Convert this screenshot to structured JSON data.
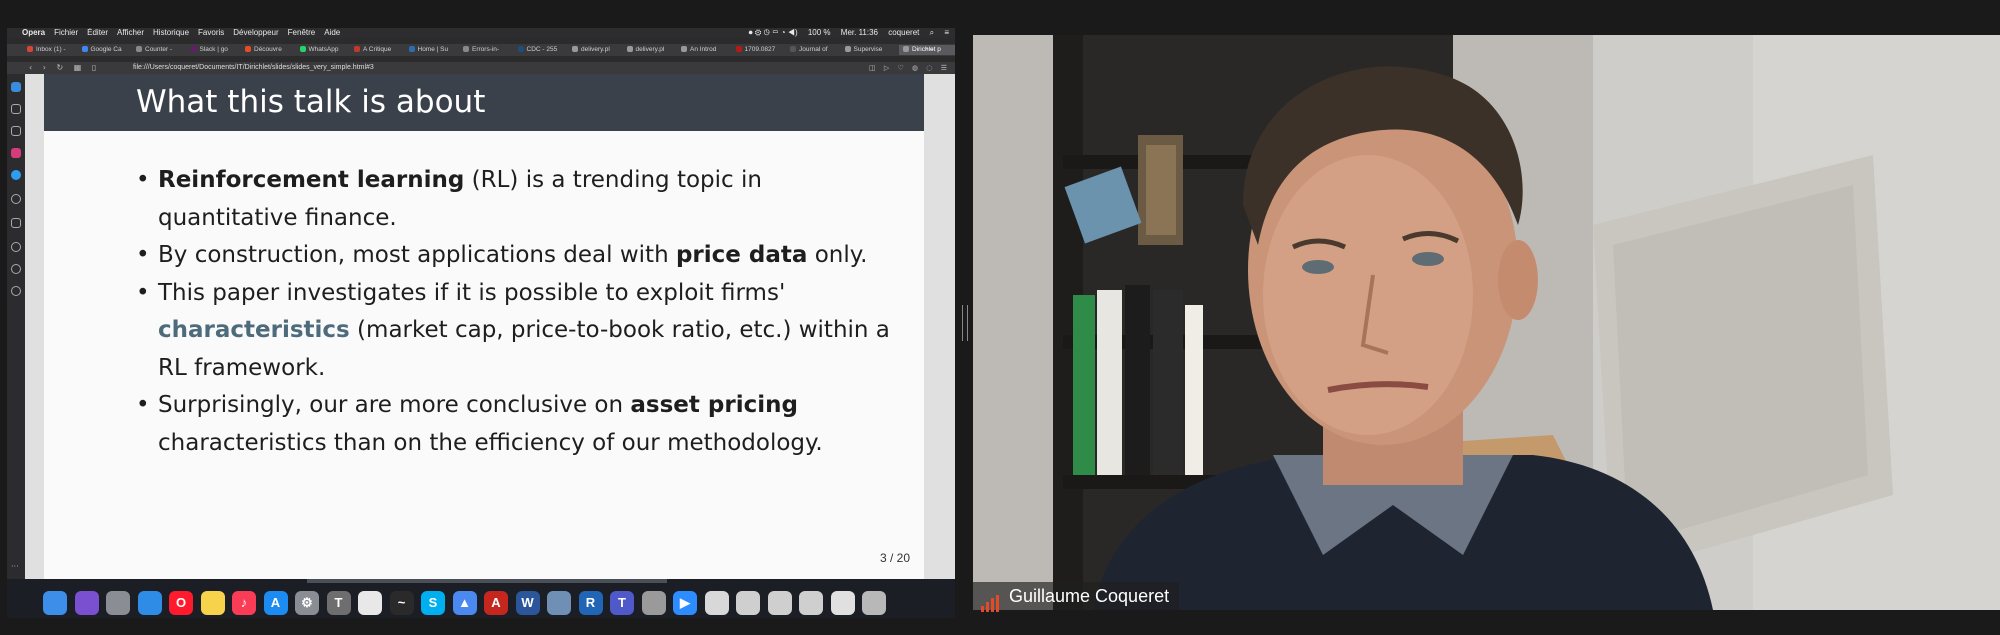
{
  "macbar": {
    "left": [
      "",
      "Opera",
      "Fichier",
      "Éditer",
      "Afficher",
      "Historique",
      "Favoris",
      "Développeur",
      "Fenêtre",
      "Aide"
    ],
    "battery": "100 %",
    "datetime": "Mer. 11:36",
    "user": "coqueret"
  },
  "tabs": [
    {
      "label": "Inbox (1) -",
      "color": "#d44638"
    },
    {
      "label": "Google Ca",
      "color": "#4285f4"
    },
    {
      "label": "Counter -",
      "color": "#888888"
    },
    {
      "label": "Slack | go",
      "color": "#611f69"
    },
    {
      "label": "Découvre",
      "color": "#e44d26"
    },
    {
      "label": "WhatsApp",
      "color": "#25d366"
    },
    {
      "label": "A Critique",
      "color": "#c0392b"
    },
    {
      "label": "Home | Su",
      "color": "#2a6db0"
    },
    {
      "label": "Errors-in-",
      "color": "#888888"
    },
    {
      "label": "CDC - 255",
      "color": "#1f4e79"
    },
    {
      "label": "delivery.pl",
      "color": "#999999"
    },
    {
      "label": "delivery.pl",
      "color": "#999999"
    },
    {
      "label": "An Introd",
      "color": "#999999"
    },
    {
      "label": "1709.0827",
      "color": "#b31b1b"
    },
    {
      "label": "Journal of",
      "color": "#555555"
    },
    {
      "label": "Supervise",
      "color": "#999999"
    },
    {
      "label": "Dirichlet p",
      "color": "#999999",
      "active": true
    }
  ],
  "url": "file:///Users/coqueret/Documents/IT/Dirichlet/slides/slides_very_simple.html#3",
  "slide": {
    "title": "What this talk is about",
    "page": "3 / 20",
    "bullets": [
      {
        "bold": "Reinforcement learning",
        "rest": " (RL) is a trending topic in quantitative finance."
      },
      {
        "pre": "By construction, most applications deal with ",
        "bold": "price data",
        "post": " only."
      },
      {
        "pre": "This paper investigates if it is possible to exploit firms' ",
        "accent": "characteristics",
        "post": " (market cap, price-to-book ratio, etc.) within a RL framework."
      },
      {
        "pre": "Surprisingly, our are more conclusive on ",
        "bold": "asset pricing",
        "post": " characteristics than on the efficiency of our methodology."
      }
    ]
  },
  "dock": [
    {
      "icon": "finder-icon",
      "color": "#3d8ee8",
      "glyph": ""
    },
    {
      "icon": "siri-icon",
      "color": "#7a4fd0",
      "glyph": ""
    },
    {
      "icon": "launchpad-icon",
      "color": "#8a8d93",
      "glyph": ""
    },
    {
      "icon": "safari-icon",
      "color": "#2f8ce6",
      "glyph": ""
    },
    {
      "icon": "opera-icon",
      "color": "#ff1b2d",
      "glyph": "O"
    },
    {
      "icon": "notes-icon",
      "color": "#f6d34a",
      "glyph": ""
    },
    {
      "icon": "music-icon",
      "color": "#fa3c57",
      "glyph": "♪"
    },
    {
      "icon": "app-store-icon",
      "color": "#1d8cf2",
      "glyph": "A"
    },
    {
      "icon": "system-preferences-icon",
      "color": "#8a8d93",
      "glyph": "⚙"
    },
    {
      "icon": "tex-icon",
      "color": "#6e6e6e",
      "glyph": "T"
    },
    {
      "icon": "textedit-icon",
      "color": "#e8e8e8",
      "glyph": ""
    },
    {
      "icon": "activity-monitor-icon",
      "color": "#2a2a2a",
      "glyph": "~"
    },
    {
      "icon": "skype-icon",
      "color": "#00aff0",
      "glyph": "S"
    },
    {
      "icon": "drive-icon",
      "color": "#4a8af0",
      "glyph": "▲"
    },
    {
      "icon": "acrobat-icon",
      "color": "#c5271f",
      "glyph": "A"
    },
    {
      "icon": "word-icon",
      "color": "#2b579a",
      "glyph": "W"
    },
    {
      "icon": "preview-icon",
      "color": "#6f8fb5",
      "glyph": ""
    },
    {
      "icon": "r-icon",
      "color": "#2165b6",
      "glyph": "R"
    },
    {
      "icon": "teams-icon",
      "color": "#5059c9",
      "glyph": "T"
    },
    {
      "icon": "archive-icon",
      "color": "#9a9a9a",
      "glyph": ""
    },
    {
      "icon": "zoom-icon",
      "color": "#2d8cff",
      "glyph": "▶"
    },
    {
      "icon": "document-icon",
      "color": "#d8d8d8",
      "glyph": ""
    },
    {
      "icon": "screenshot-thumb-icon",
      "color": "#cfcfcf",
      "glyph": ""
    },
    {
      "icon": "screenshot-thumb-icon-2",
      "color": "#cfcfcf",
      "glyph": ""
    },
    {
      "icon": "screenshot-thumb-icon-3",
      "color": "#cfcfcf",
      "glyph": ""
    },
    {
      "icon": "window-thumb-icon",
      "color": "#e0e0e0",
      "glyph": ""
    },
    {
      "icon": "trash-icon",
      "color": "#b8b8b8",
      "glyph": ""
    }
  ],
  "participant": {
    "name": "Guillaume Coqueret",
    "mic_color": "#e04b2a"
  }
}
